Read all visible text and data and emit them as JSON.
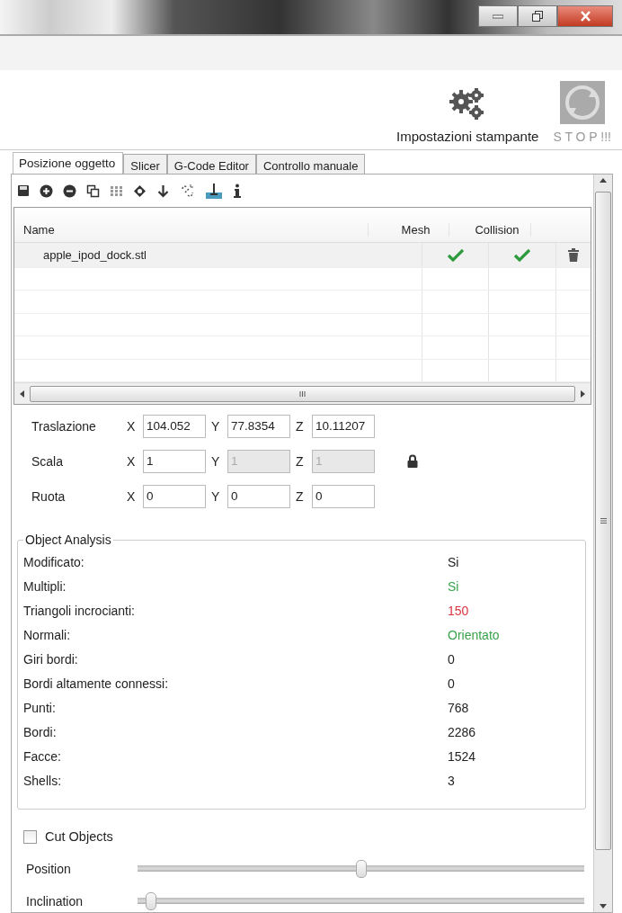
{
  "header": {
    "printer_settings": "Impostazioni stampante",
    "stop": "S T O P !!!"
  },
  "tabs": [
    {
      "label": "Posizione oggetto",
      "selected": true
    },
    {
      "label": "Slicer",
      "selected": false
    },
    {
      "label": "G-Code Editor",
      "selected": false
    },
    {
      "label": "Controllo manuale",
      "selected": false
    }
  ],
  "table": {
    "columns": [
      "Name",
      "Mesh",
      "Collision"
    ],
    "rows": [
      {
        "name": "apple_ipod_dock.stl",
        "mesh": true,
        "collision": true
      }
    ]
  },
  "scrollbar_label": "III",
  "transform": [
    {
      "label": "Traslazione",
      "fields": [
        {
          "axis": "X",
          "value": "104.052",
          "disabled": false
        },
        {
          "axis": "Y",
          "value": "77.8354",
          "disabled": false
        },
        {
          "axis": "Z",
          "value": "10.11207",
          "disabled": false
        }
      ],
      "lock": false
    },
    {
      "label": "Scala",
      "fields": [
        {
          "axis": "X",
          "value": "1",
          "disabled": false
        },
        {
          "axis": "Y",
          "value": "1",
          "disabled": true
        },
        {
          "axis": "Z",
          "value": "1",
          "disabled": true
        }
      ],
      "lock": true
    },
    {
      "label": "Ruota",
      "fields": [
        {
          "axis": "X",
          "value": "0",
          "disabled": false
        },
        {
          "axis": "Y",
          "value": "0",
          "disabled": false
        },
        {
          "axis": "Z",
          "value": "0",
          "disabled": false
        }
      ],
      "lock": false
    }
  ],
  "analysis": {
    "title": "Object Analysis",
    "rows": [
      {
        "label": "Modificato:",
        "value": "Si",
        "color": "#222222"
      },
      {
        "label": "Multipli:",
        "value": "Si",
        "color": "#3aa34a"
      },
      {
        "label": "Triangoli incrocianti:",
        "value": "150",
        "color": "#d9343f"
      },
      {
        "label": "Normali:",
        "value": "Orientato",
        "color": "#3aa34a"
      },
      {
        "label": "Giri bordi:",
        "value": "0",
        "color": "#222222"
      },
      {
        "label": "Bordi altamente connessi:",
        "value": "0",
        "color": "#222222"
      },
      {
        "label": "Punti:",
        "value": "768",
        "color": "#222222"
      },
      {
        "label": "Bordi:",
        "value": "2286",
        "color": "#222222"
      },
      {
        "label": "Facce:",
        "value": "1524",
        "color": "#222222"
      },
      {
        "label": "Shells:",
        "value": "3",
        "color": "#222222"
      }
    ]
  },
  "cut_objects": {
    "label": "Cut Objects",
    "checked": false
  },
  "sliders": [
    {
      "label": "Position",
      "level": 0.5
    },
    {
      "label": "Inclination",
      "level": 0
    }
  ]
}
